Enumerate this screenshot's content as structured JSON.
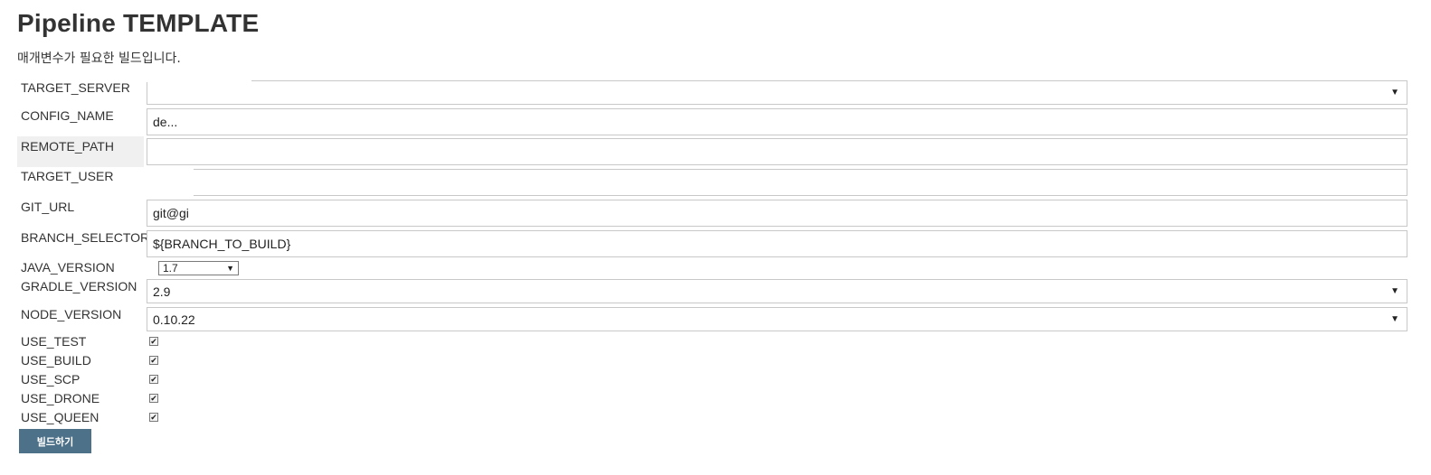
{
  "page": {
    "title": "Pipeline TEMPLATE",
    "description": "매개변수가 필요한 빌드입니다."
  },
  "parameters": {
    "target_server": {
      "label": "TARGET_SERVER",
      "value": ""
    },
    "config_name": {
      "label": "CONFIG_NAME",
      "value": "de..."
    },
    "remote_path": {
      "label": "REMOTE_PATH",
      "value": ""
    },
    "target_user": {
      "label": "TARGET_USER",
      "value": ""
    },
    "git_url": {
      "label": "GIT_URL",
      "value": "git@gi"
    },
    "branch_selector": {
      "label": "BRANCH_SELECTOR",
      "value": "${BRANCH_TO_BUILD}"
    },
    "java_version": {
      "label": "JAVA_VERSION",
      "value": "1.7"
    },
    "gradle_version": {
      "label": "GRADLE_VERSION",
      "value": "2.9"
    },
    "node_version": {
      "label": "NODE_VERSION",
      "value": "0.10.22"
    }
  },
  "checkboxes": [
    {
      "label": "USE_TEST",
      "checked": true
    },
    {
      "label": "USE_BUILD",
      "checked": true
    },
    {
      "label": "USE_SCP",
      "checked": true
    },
    {
      "label": "USE_DRONE",
      "checked": true
    },
    {
      "label": "USE_QUEEN",
      "checked": true
    }
  ],
  "actions": {
    "build_label": "빌드하기"
  },
  "icons": {
    "dropdown": "triangle-down-icon",
    "check": "checkmark-icon"
  },
  "colors": {
    "button_bg": "#4d7189",
    "row_highlight": "#f0f0f0"
  }
}
